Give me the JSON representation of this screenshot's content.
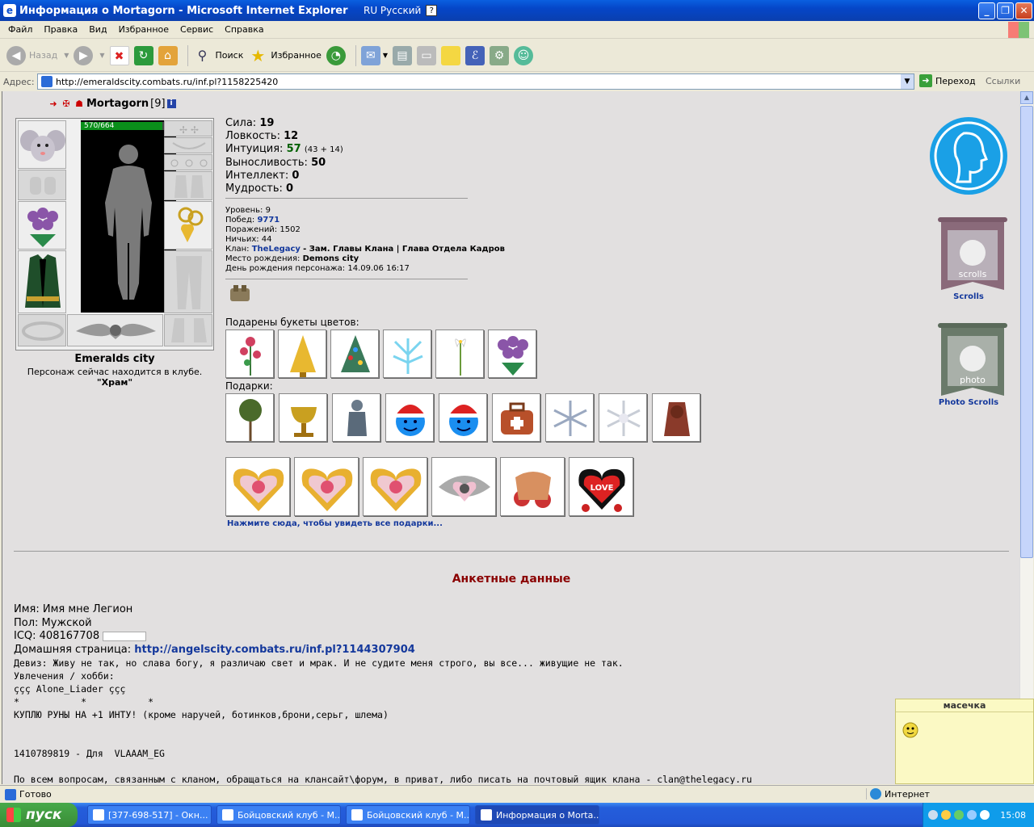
{
  "window": {
    "title": "Информация о Mortagorn - Microsoft Internet Explorer",
    "language": "RU Русский",
    "help_glyph": "?"
  },
  "menu": [
    "Файл",
    "Правка",
    "Вид",
    "Избранное",
    "Сервис",
    "Справка"
  ],
  "toolbar": {
    "back": "Назад",
    "search": "Поиск",
    "favorites": "Избранное"
  },
  "address": {
    "label": "Адрес:",
    "url": "http://emeraldscity.combats.ru/inf.pl?1158225420",
    "go": "Переход",
    "links": "Ссылки"
  },
  "character": {
    "nick": "Mortagorn",
    "level_tag": "[9]",
    "info_glyph": "i",
    "hp_text": "570/664",
    "hp_fraction": 0.859,
    "city": "Emeralds city",
    "location_text": "Персонаж сейчас находится в клубе.",
    "location_place": "\"Храм\""
  },
  "stats": [
    {
      "label": "Сила:",
      "value": "19",
      "extra": ""
    },
    {
      "label": "Ловкость:",
      "value": "12",
      "extra": ""
    },
    {
      "label": "Интуиция:",
      "value": "57",
      "extra": "(43 + 14)"
    },
    {
      "label": "Выносливость:",
      "value": "50",
      "extra": ""
    },
    {
      "label": "Интеллект:",
      "value": "0",
      "extra": ""
    },
    {
      "label": "Мудрость:",
      "value": "0",
      "extra": ""
    }
  ],
  "info": {
    "level_label": "Уровень:",
    "level": "9",
    "wins_label": "Побед:",
    "wins": "9771",
    "losses_label": "Поражений:",
    "losses": "1502",
    "draws_label": "Ничьих:",
    "draws": "44",
    "clan_label": "Клан:",
    "clan": "TheLegacy",
    "clan_role": "- Зам. Главы Клана | Глава Отдела Кадров",
    "birthplace_label": "Место рождения:",
    "birthplace": "Demons city",
    "birthday_label": "День рождения персонажа:",
    "birthday": "14.09.06 16:17"
  },
  "bouquets_label": "Подарены букеты цветов:",
  "gifts_label": "Подарки:",
  "see_all": "Нажмите сюда, чтобы увидеть все подарки...",
  "anket_title": "Анкетные данные",
  "profile": {
    "name": "Имя: Имя мне Легион",
    "sex": "Пол: Мужской",
    "icq": "ICQ: 408167708",
    "home_label": "Домашняя страница:",
    "home_url": "http://angelscity.combats.ru/inf.pl?1144307904",
    "motto": "Девиз: Живу не так, но слава богу, я различаю свет и мрак. И не судите меня строго, вы все... живущие не так.",
    "hobby_label": "Увлечения / хобби:",
    "hobby_lines": [
      "ççç Alone_Liader ççç",
      "*           *           *",
      "КУПЛЮ РУНЫ НА +1 ИНТУ! (кроме наручей, ботинков,брони,серьг, шлема)",
      "",
      "",
      "1410789819 - Для  VLAAAM_EG",
      "",
      "По всем вопросам, связанным с кланом, обращаться на клансайт\\форум, в приват, либо писать на почтовый ящик клана - clan@thelegacy.ru"
    ]
  },
  "right_panel": {
    "scrolls": "Scrolls",
    "scrolls_sign": "scrolls",
    "photo_scrolls": "Photo Scrolls",
    "photo_sign": "photo"
  },
  "popup_title": "масечка",
  "status": {
    "done": "Готово",
    "zone": "Интернет"
  },
  "taskbar": {
    "start": "пуск",
    "tasks": [
      "[377-698-517] - Окн...",
      "Бойцовский клуб - М...",
      "Бойцовский клуб - М...",
      "Информация о Morta..."
    ],
    "clock": "15:08"
  },
  "bouquet_icons": [
    "rose-bouquet-icon",
    "gold-tree-bouquet-icon",
    "christmas-tree-bouquet-icon",
    "frost-bouquet-icon",
    "lily-bouquet-icon",
    "violet-roses-bouquet-icon"
  ],
  "gift_icons": [
    "broom-gift-icon",
    "chalice-gift-icon",
    "knight-statue-gift-icon",
    "santa-smiley-gift-icon",
    "santa-smiley-gift-icon",
    "medkit-bag-gift-icon",
    "snowflake-gift-icon",
    "snowflake-white-gift-icon",
    "demon-gift-icon"
  ],
  "big_gift_icons": [
    "heart-candy-gift-icon",
    "heart-candy-gift-icon",
    "heart-candy-gift-icon",
    "emblem-heart-gift-icon",
    "basket-roses-gift-icon",
    "love-heart-gift-icon"
  ],
  "love_text": "LOVE"
}
